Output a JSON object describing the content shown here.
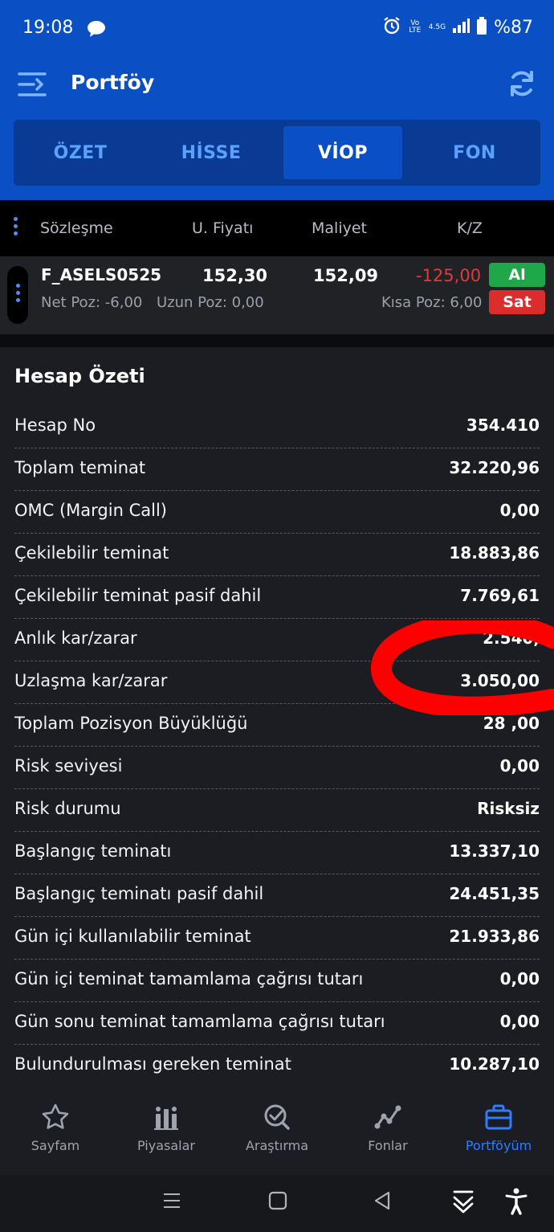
{
  "status": {
    "time": "19:08",
    "battery": "%87",
    "network": "4.5G",
    "volte": "Vo LTE"
  },
  "header": {
    "title": "Portföy"
  },
  "tabs": [
    {
      "label": "ÖZET"
    },
    {
      "label": "HİSSE"
    },
    {
      "label": "VİOP"
    },
    {
      "label": "FON"
    }
  ],
  "active_tab": "VİOP",
  "columns": {
    "contract": "Sözleşme",
    "price": "U. Fiyatı",
    "cost": "Maliyet",
    "pl": "K/Z"
  },
  "position": {
    "symbol": "F_ASELS0525",
    "price": "152,30",
    "cost": "152,09",
    "pl": "-125,00",
    "net": "Net Poz: -6,00",
    "long": "Uzun Poz: 0,00",
    "short": "Kısa Poz: 6,00",
    "buy_label": "Al",
    "sell_label": "Sat"
  },
  "summary": {
    "title": "Hesap Özeti",
    "rows": [
      {
        "label": "Hesap No",
        "value": "354.410"
      },
      {
        "label": "Toplam teminat",
        "value": "32.220,96"
      },
      {
        "label": "OMC (Margin Call)",
        "value": "0,00"
      },
      {
        "label": "Çekilebilir teminat",
        "value": "18.883,86"
      },
      {
        "label": "Çekilebilir teminat pasif dahil",
        "value": "7.769,61"
      },
      {
        "label": "Anlık kar/zarar",
        "value": "2.540,"
      },
      {
        "label": "Uzlaşma kar/zarar",
        "value": "3.050,00"
      },
      {
        "label": "Toplam Pozisyon Büyüklüğü",
        "value": "28 ,00"
      },
      {
        "label": "Risk seviyesi",
        "value": "0,00"
      },
      {
        "label": "Risk durumu",
        "value": "Risksiz"
      },
      {
        "label": "Başlangıç teminatı",
        "value": "13.337,10"
      },
      {
        "label": "Başlangıç teminatı pasif dahil",
        "value": "24.451,35"
      },
      {
        "label": "Gün içi kullanılabilir teminat",
        "value": "21.933,86"
      },
      {
        "label": "Gün içi teminat tamamlama çağrısı tutarı",
        "value": "0,00"
      },
      {
        "label": "Gün sonu teminat tamamlama çağrısı tutarı",
        "value": "0,00"
      },
      {
        "label": "Bulundurulması gereken teminat",
        "value": "10.287,10"
      }
    ]
  },
  "nav": [
    {
      "label": "Sayfam",
      "icon": "star-icon"
    },
    {
      "label": "Piyasalar",
      "icon": "market-icon"
    },
    {
      "label": "Araştırma",
      "icon": "research-icon"
    },
    {
      "label": "Fonlar",
      "icon": "funds-icon"
    },
    {
      "label": "Portföyüm",
      "icon": "briefcase-icon"
    }
  ],
  "colors": {
    "header_blue": "#0a4fc4",
    "accent": "#2f7dff",
    "loss": "#e23a3a",
    "buy": "#1fa84a",
    "sell": "#dc2d2d"
  }
}
